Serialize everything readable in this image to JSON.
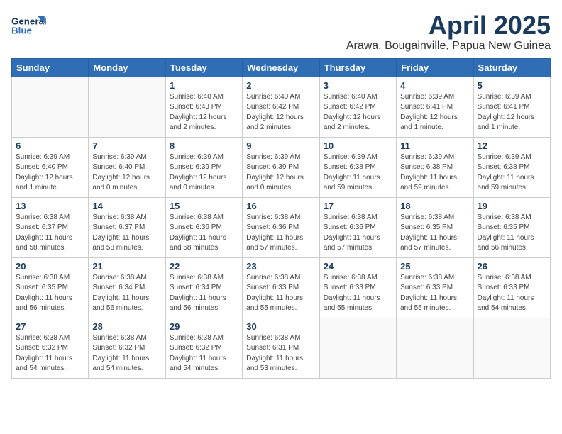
{
  "header": {
    "logo_general": "General",
    "logo_blue": "Blue",
    "month_year": "April 2025",
    "location": "Arawa, Bougainville, Papua New Guinea"
  },
  "days_of_week": [
    "Sunday",
    "Monday",
    "Tuesday",
    "Wednesday",
    "Thursday",
    "Friday",
    "Saturday"
  ],
  "weeks": [
    [
      {
        "day": "",
        "details": ""
      },
      {
        "day": "",
        "details": ""
      },
      {
        "day": "1",
        "details": "Sunrise: 6:40 AM\nSunset: 6:43 PM\nDaylight: 12 hours\nand 2 minutes."
      },
      {
        "day": "2",
        "details": "Sunrise: 6:40 AM\nSunset: 6:42 PM\nDaylight: 12 hours\nand 2 minutes."
      },
      {
        "day": "3",
        "details": "Sunrise: 6:40 AM\nSunset: 6:42 PM\nDaylight: 12 hours\nand 2 minutes."
      },
      {
        "day": "4",
        "details": "Sunrise: 6:39 AM\nSunset: 6:41 PM\nDaylight: 12 hours\nand 1 minute."
      },
      {
        "day": "5",
        "details": "Sunrise: 6:39 AM\nSunset: 6:41 PM\nDaylight: 12 hours\nand 1 minute."
      }
    ],
    [
      {
        "day": "6",
        "details": "Sunrise: 6:39 AM\nSunset: 6:40 PM\nDaylight: 12 hours\nand 1 minute."
      },
      {
        "day": "7",
        "details": "Sunrise: 6:39 AM\nSunset: 6:40 PM\nDaylight: 12 hours\nand 0 minutes."
      },
      {
        "day": "8",
        "details": "Sunrise: 6:39 AM\nSunset: 6:39 PM\nDaylight: 12 hours\nand 0 minutes."
      },
      {
        "day": "9",
        "details": "Sunrise: 6:39 AM\nSunset: 6:39 PM\nDaylight: 12 hours\nand 0 minutes."
      },
      {
        "day": "10",
        "details": "Sunrise: 6:39 AM\nSunset: 6:38 PM\nDaylight: 11 hours\nand 59 minutes."
      },
      {
        "day": "11",
        "details": "Sunrise: 6:39 AM\nSunset: 6:38 PM\nDaylight: 11 hours\nand 59 minutes."
      },
      {
        "day": "12",
        "details": "Sunrise: 6:39 AM\nSunset: 6:38 PM\nDaylight: 11 hours\nand 59 minutes."
      }
    ],
    [
      {
        "day": "13",
        "details": "Sunrise: 6:38 AM\nSunset: 6:37 PM\nDaylight: 11 hours\nand 58 minutes."
      },
      {
        "day": "14",
        "details": "Sunrise: 6:38 AM\nSunset: 6:37 PM\nDaylight: 11 hours\nand 58 minutes."
      },
      {
        "day": "15",
        "details": "Sunrise: 6:38 AM\nSunset: 6:36 PM\nDaylight: 11 hours\nand 58 minutes."
      },
      {
        "day": "16",
        "details": "Sunrise: 6:38 AM\nSunset: 6:36 PM\nDaylight: 11 hours\nand 57 minutes."
      },
      {
        "day": "17",
        "details": "Sunrise: 6:38 AM\nSunset: 6:36 PM\nDaylight: 11 hours\nand 57 minutes."
      },
      {
        "day": "18",
        "details": "Sunrise: 6:38 AM\nSunset: 6:35 PM\nDaylight: 11 hours\nand 57 minutes."
      },
      {
        "day": "19",
        "details": "Sunrise: 6:38 AM\nSunset: 6:35 PM\nDaylight: 11 hours\nand 56 minutes."
      }
    ],
    [
      {
        "day": "20",
        "details": "Sunrise: 6:38 AM\nSunset: 6:35 PM\nDaylight: 11 hours\nand 56 minutes."
      },
      {
        "day": "21",
        "details": "Sunrise: 6:38 AM\nSunset: 6:34 PM\nDaylight: 11 hours\nand 56 minutes."
      },
      {
        "day": "22",
        "details": "Sunrise: 6:38 AM\nSunset: 6:34 PM\nDaylight: 11 hours\nand 56 minutes."
      },
      {
        "day": "23",
        "details": "Sunrise: 6:38 AM\nSunset: 6:33 PM\nDaylight: 11 hours\nand 55 minutes."
      },
      {
        "day": "24",
        "details": "Sunrise: 6:38 AM\nSunset: 6:33 PM\nDaylight: 11 hours\nand 55 minutes."
      },
      {
        "day": "25",
        "details": "Sunrise: 6:38 AM\nSunset: 6:33 PM\nDaylight: 11 hours\nand 55 minutes."
      },
      {
        "day": "26",
        "details": "Sunrise: 6:38 AM\nSunset: 6:33 PM\nDaylight: 11 hours\nand 54 minutes."
      }
    ],
    [
      {
        "day": "27",
        "details": "Sunrise: 6:38 AM\nSunset: 6:32 PM\nDaylight: 11 hours\nand 54 minutes."
      },
      {
        "day": "28",
        "details": "Sunrise: 6:38 AM\nSunset: 6:32 PM\nDaylight: 11 hours\nand 54 minutes."
      },
      {
        "day": "29",
        "details": "Sunrise: 6:38 AM\nSunset: 6:32 PM\nDaylight: 11 hours\nand 54 minutes."
      },
      {
        "day": "30",
        "details": "Sunrise: 6:38 AM\nSunset: 6:31 PM\nDaylight: 11 hours\nand 53 minutes."
      },
      {
        "day": "",
        "details": ""
      },
      {
        "day": "",
        "details": ""
      },
      {
        "day": "",
        "details": ""
      }
    ]
  ]
}
